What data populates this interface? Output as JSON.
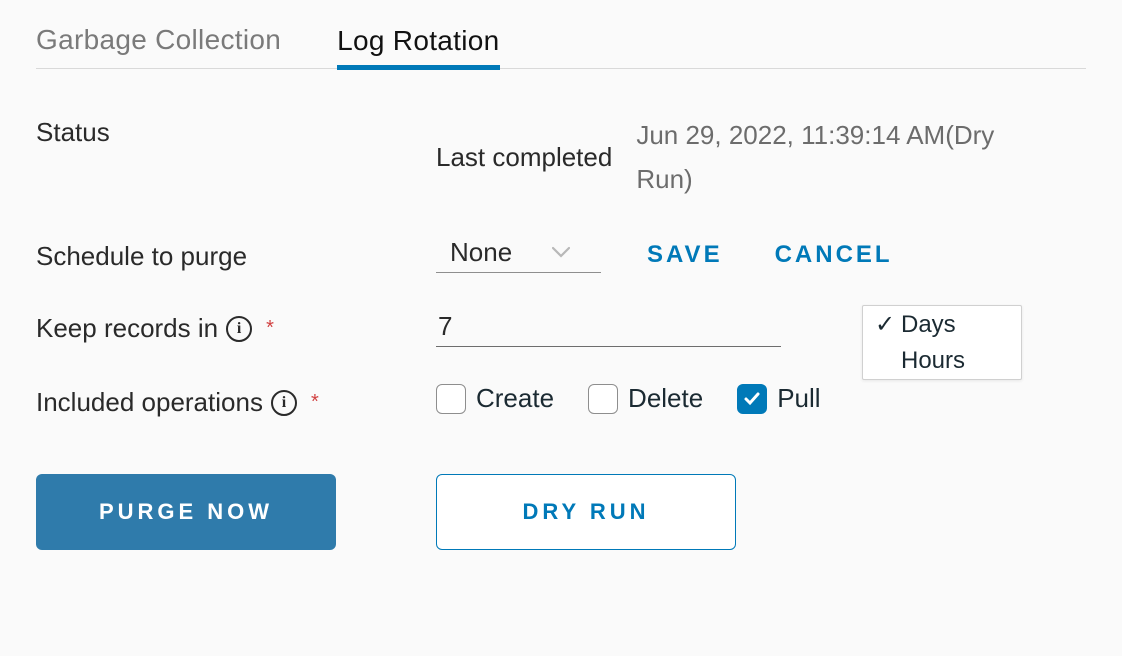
{
  "tabs": {
    "garbage_collection": "Garbage Collection",
    "log_rotation": "Log Rotation"
  },
  "status": {
    "label": "Status",
    "metric": "Last completed",
    "value": "Jun 29, 2022, 11:39:14 AM(Dry Run)"
  },
  "schedule": {
    "label": "Schedule to purge",
    "selected": "None",
    "save": "SAVE",
    "cancel": "CANCEL"
  },
  "keep_records": {
    "label": "Keep records in",
    "value": "7",
    "unit_options": {
      "days": "Days",
      "hours": "Hours"
    },
    "selected_unit": "days"
  },
  "included_operations": {
    "label": "Included operations",
    "create": {
      "label": "Create",
      "checked": false
    },
    "delete": {
      "label": "Delete",
      "checked": false
    },
    "pull": {
      "label": "Pull",
      "checked": true
    }
  },
  "actions": {
    "purge_now": "PURGE NOW",
    "dry_run": "DRY RUN"
  }
}
